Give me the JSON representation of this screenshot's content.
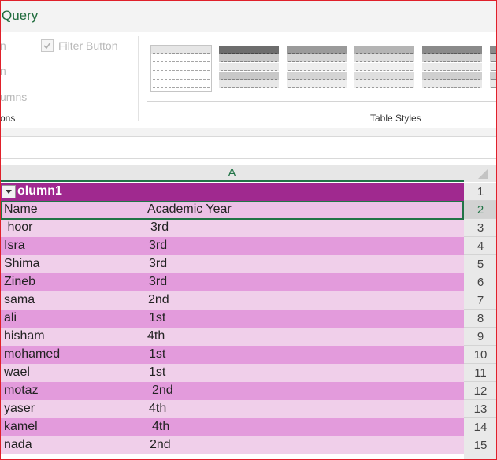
{
  "ribbon": {
    "tab_title": "Query",
    "ghost_items": [
      "n",
      "n",
      "umns"
    ],
    "filter_button_label": "Filter Button",
    "filter_button_checked": true,
    "left_group_label": "ons",
    "table_styles_label": "Table Styles"
  },
  "sheet": {
    "column_header": "A",
    "table_header": "olumn1",
    "accent_color": "#a0298f",
    "rows": [
      {
        "num": "1"
      },
      {
        "num": "2",
        "name": "Name",
        "year": "Academic Year"
      },
      {
        "num": "3",
        "name": " hoor",
        "year": "3rd"
      },
      {
        "num": "4",
        "name": "Isra",
        "year": "3rd"
      },
      {
        "num": "5",
        "name": "Shima",
        "year": "3rd"
      },
      {
        "num": "6",
        "name": "Zineb",
        "year": "3rd"
      },
      {
        "num": "7",
        "name": "sama",
        "year": "2nd"
      },
      {
        "num": "8",
        "name": "ali",
        "year": "1st"
      },
      {
        "num": "9",
        "name": "hisham",
        "year": "4th"
      },
      {
        "num": "10",
        "name": "mohamed",
        "year": "1st"
      },
      {
        "num": "11",
        "name": "wael",
        "year": "1st"
      },
      {
        "num": "12",
        "name": "motaz",
        "year": "2nd"
      },
      {
        "num": "13",
        "name": "yaser",
        "year": "4th"
      },
      {
        "num": "14",
        "name": "kamel",
        "year": "4th"
      },
      {
        "num": "15",
        "name": "nada",
        "year": "2nd"
      }
    ]
  }
}
